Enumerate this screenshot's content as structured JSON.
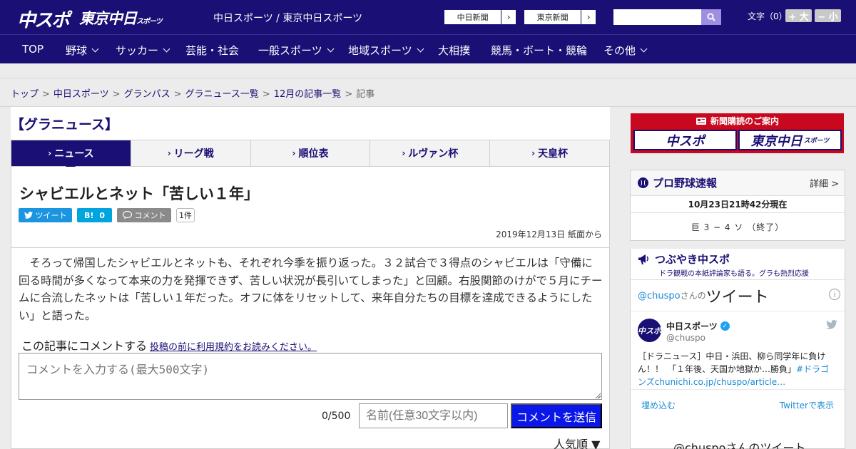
{
  "header": {
    "logo_chuspo": "中スポ",
    "logo_tokyo": "東京中日",
    "logo_tokyo_small": "スポーツ",
    "site_title": "中日スポーツ / 東京中日スポーツ",
    "paper_links": [
      {
        "label": "中日新聞",
        "arrow": "›"
      },
      {
        "label": "東京新聞",
        "arrow": "›"
      }
    ],
    "search": {
      "value": ""
    },
    "font_size_label": "文字（0）",
    "font_plus": "+ 大",
    "font_minus": "− 小"
  },
  "nav": {
    "items": [
      {
        "label": "TOP"
      },
      {
        "label": "野球"
      },
      {
        "label": "サッカー"
      },
      {
        "label": "芸能・社会"
      },
      {
        "label": "一般スポーツ"
      },
      {
        "label": "地域スポーツ"
      },
      {
        "label": "大相撲"
      },
      {
        "label": "競馬・ボート・競輪"
      },
      {
        "label": "その他"
      }
    ]
  },
  "breadcrumb": {
    "items": [
      "トップ",
      "中日スポーツ",
      "グランパス",
      "グラニュース一覧",
      "12月の記事一覧"
    ],
    "current": "記事",
    "sep": ">"
  },
  "section_title": "【グラニュース】",
  "tabs": [
    {
      "label": "ニュース",
      "mark": "›"
    },
    {
      "label": "リーグ戦",
      "mark": "›"
    },
    {
      "label": "順位表",
      "mark": "›"
    },
    {
      "label": "ルヴァン杯",
      "mark": "›"
    },
    {
      "label": "天皇杯",
      "mark": "›"
    }
  ],
  "article": {
    "title": "シャビエルとネット「苦しい１年」",
    "share": {
      "tweet": "ツイート",
      "hatena_label": "B!",
      "hatena_count": "0",
      "comment": "コメント",
      "comment_count": "1件"
    },
    "date": "2019年12月13日 紙面から",
    "body": "そろって帰国したシャビエルとネットも、それぞれ今季を振り返った。３２試合で３得点のシャビエルは「守備に回る時間が多くなって本来の力を発揮できず、苦しい状況が長引いてしまった」と回顧。右股関節のけがで５月にチームに合流したネットは「苦しい１年だった。オフに体をリセットして、来年自分たちの目標を達成できるようにしたい」と語った。"
  },
  "comment_form": {
    "heading": "この記事にコメントする",
    "terms_link": "投稿の前に利用規約をお読みください。",
    "textarea_placeholder": "コメントを入力する(最大500文字)",
    "char_count": "0/500",
    "name_placeholder": "名前(任意30文字以内)",
    "submit": "コメントを送信",
    "sort": "人気順 ▼"
  },
  "sidebar": {
    "ad": {
      "heading": "新聞購読のご案内",
      "btn1": "中スポ",
      "btn2": "東京中日",
      "btn2_small": "スポーツ"
    },
    "baseball": {
      "title": "プロ野球速報",
      "detail": "詳細 >",
      "time": "10月23日21時42分現在",
      "score": "巨 3 − 4 ソ （終了）"
    },
    "tsubuyaki": {
      "title": "つぶやき中スポ",
      "subtitle": "ドラ観戦の本紙評論家も語る。グラも熱烈応援"
    },
    "twitter": {
      "handle": "@chuspo",
      "handle_suffix": "さんの",
      "heading": "ツイート",
      "info": "i",
      "tweet": {
        "name": "中日スポーツ",
        "verified": "✓",
        "screen_name": "@chuspo",
        "text": "［ドラニュース］中日・浜田、柳ら同学年に負けん！！　「１年後、天国か地獄か…勝負」",
        "hashtag": "#ドラゴンズ",
        "link": "chunichi.co.jp/chuspo/article…"
      },
      "embed": "埋め込む",
      "view_on": "Twitterで表示",
      "next": "@chuspoさんのツイート"
    }
  },
  "colors": {
    "brand_navy": "#190f74",
    "ad_red": "#c7081e",
    "submit_blue": "#0b16e8",
    "twitter_blue": "#1da1f2"
  }
}
